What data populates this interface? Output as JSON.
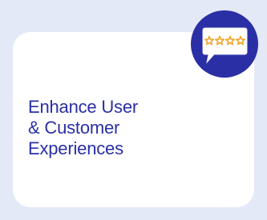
{
  "card": {
    "headline_lines": [
      "Enhance User",
      "& Customer",
      "Experiences"
    ]
  },
  "icon": {
    "name": "review-stars-speech-bubble-icon",
    "star_count": 4
  },
  "colors": {
    "page_background": "#e4e9f8",
    "card_background": "#ffffff",
    "headline_text": "#2a2fa5",
    "icon_circle": "#2a2fa5",
    "bubble_fill": "#ffffff",
    "star_outline": "#f2a62b"
  }
}
